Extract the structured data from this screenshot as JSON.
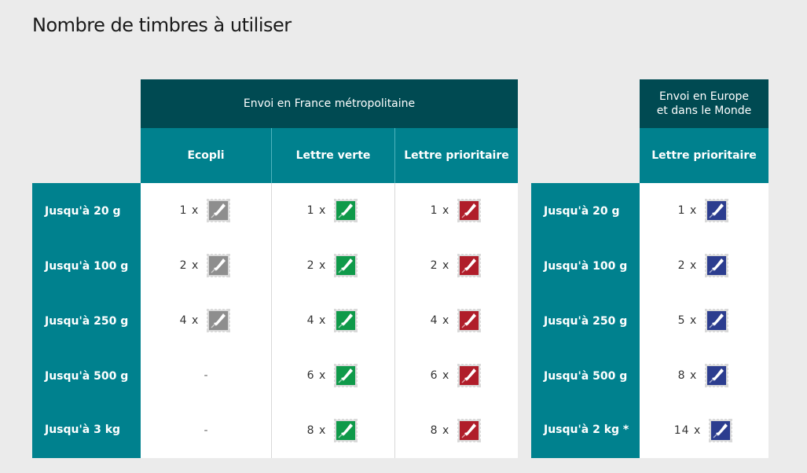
{
  "title": "Nombre de timbres à utiliser",
  "colors": {
    "header_dark": "#004a52",
    "header_teal": "#00818e",
    "stamp_ecopli": "#8e8e8e",
    "stamp_verte": "#0f9a4a",
    "stamp_prioritaire": "#b01d2a",
    "stamp_monde": "#2c3d8f"
  },
  "france": {
    "group_header": "Envoi en France métropolitaine",
    "columns": [
      "Ecopli",
      "Lettre verte",
      "Lettre prioritaire"
    ],
    "rows": [
      {
        "label": "Jusqu'à 20 g",
        "values": [
          "1 x",
          "1 x",
          "1 x"
        ]
      },
      {
        "label": "Jusqu'à 100 g",
        "values": [
          "2 x",
          "2 x",
          "2 x"
        ]
      },
      {
        "label": "Jusqu'à 250 g",
        "values": [
          "4 x",
          "4 x",
          "4 x"
        ]
      },
      {
        "label": "Jusqu'à 500 g",
        "values": [
          "-",
          "6 x",
          "6 x"
        ]
      },
      {
        "label": "Jusqu'à 3 kg",
        "values": [
          "-",
          "8 x",
          "8 x"
        ]
      }
    ]
  },
  "world": {
    "group_header_line1": "Envoi en Europe",
    "group_header_line2": "et dans le Monde",
    "column": "Lettre prioritaire",
    "rows": [
      {
        "label": "Jusqu'à 20 g",
        "value": "1 x"
      },
      {
        "label": "Jusqu'à 100 g",
        "value": "2 x"
      },
      {
        "label": "Jusqu'à 250 g",
        "value": "5 x"
      },
      {
        "label": "Jusqu'à 500 g",
        "value": "8 x"
      },
      {
        "label": "Jusqu'à 2 kg *",
        "value": "14 x"
      }
    ]
  }
}
